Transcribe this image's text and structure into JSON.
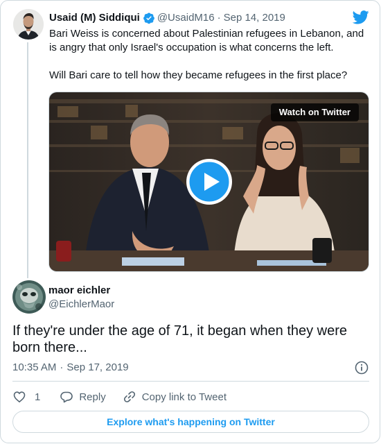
{
  "parent_tweet": {
    "author_name": "Usaid (M) Siddiqui",
    "handle": "@UsaidM16",
    "separator": "·",
    "date": "Sep 14, 2019",
    "verified": true,
    "paragraphs": [
      "Bari Weiss is concerned about Palestinian refugees in Lebanon, and is angry that only Israel's occupation is what concerns the left.",
      "Will Bari care to tell how they became refugees in the first place?"
    ],
    "media": {
      "watch_label": "Watch on Twitter",
      "play_icon": "play-icon"
    }
  },
  "tweet": {
    "author_name": "maor eichler",
    "handle": "@EichlerMaor",
    "text": "If they're under the age of 71, it began when they were born there...",
    "time": "10:35 AM",
    "separator": "·",
    "date": "Sep 17, 2019"
  },
  "actions": {
    "like_count": "1",
    "reply_label": "Reply",
    "copy_link_label": "Copy link to Tweet"
  },
  "footer": {
    "explore_label": "Explore what's happening on Twitter"
  },
  "colors": {
    "brand": "#1d9bf0",
    "text": "#0f1419",
    "secondary_text": "#536471",
    "border": "#cfd9de"
  }
}
